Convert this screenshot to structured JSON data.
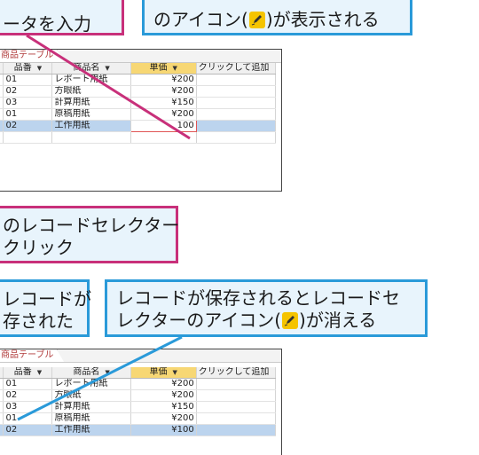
{
  "callouts": {
    "top_left": {
      "line1": "ータを入力"
    },
    "top_right": {
      "line1": "のアイコン(",
      "line1_after": ")が表示される"
    },
    "mid_left": {
      "line1": "のレコードセレクター",
      "line2": "クリック"
    },
    "bottom_left": {
      "line1": "レコードが",
      "line2": "存された"
    },
    "bottom_right": {
      "line1": "レコードが保存されるとレコードセ",
      "line2": "レクターのアイコン(",
      "line2_after": ")が消える"
    }
  },
  "colors": {
    "pink": "#c8307a",
    "blue": "#2a9ad9",
    "selected_row": "#bcd4ee",
    "selected_header": "#f7d774"
  },
  "icons": {
    "pencil": "pencil-edit-icon"
  },
  "table_top": {
    "tab_label": "商品テーブル",
    "columns": [
      "品番",
      "商品名",
      "単価",
      "クリックして追加"
    ],
    "rows": [
      {
        "code": "01",
        "name": "レポート用紙",
        "price": "¥200"
      },
      {
        "code": "02",
        "name": "方眼紙",
        "price": "¥200"
      },
      {
        "code": "03",
        "name": "計算用紙",
        "price": "¥150"
      },
      {
        "code": "01",
        "name": "原稿用紙",
        "price": "¥200"
      },
      {
        "code": "02",
        "name": "工作用紙",
        "price": "100"
      }
    ]
  },
  "table_bottom": {
    "tab_label": "商品テーブル",
    "columns": [
      "品番",
      "商品名",
      "単価",
      "クリックして追加"
    ],
    "rows": [
      {
        "code": "01",
        "name": "レポート用紙",
        "price": "¥200"
      },
      {
        "code": "02",
        "name": "方眼紙",
        "price": "¥200"
      },
      {
        "code": "03",
        "name": "計算用紙",
        "price": "¥150"
      },
      {
        "code": "01",
        "name": "原稿用紙",
        "price": "¥200"
      },
      {
        "code": "02",
        "name": "工作用紙",
        "price": "¥100"
      }
    ]
  }
}
